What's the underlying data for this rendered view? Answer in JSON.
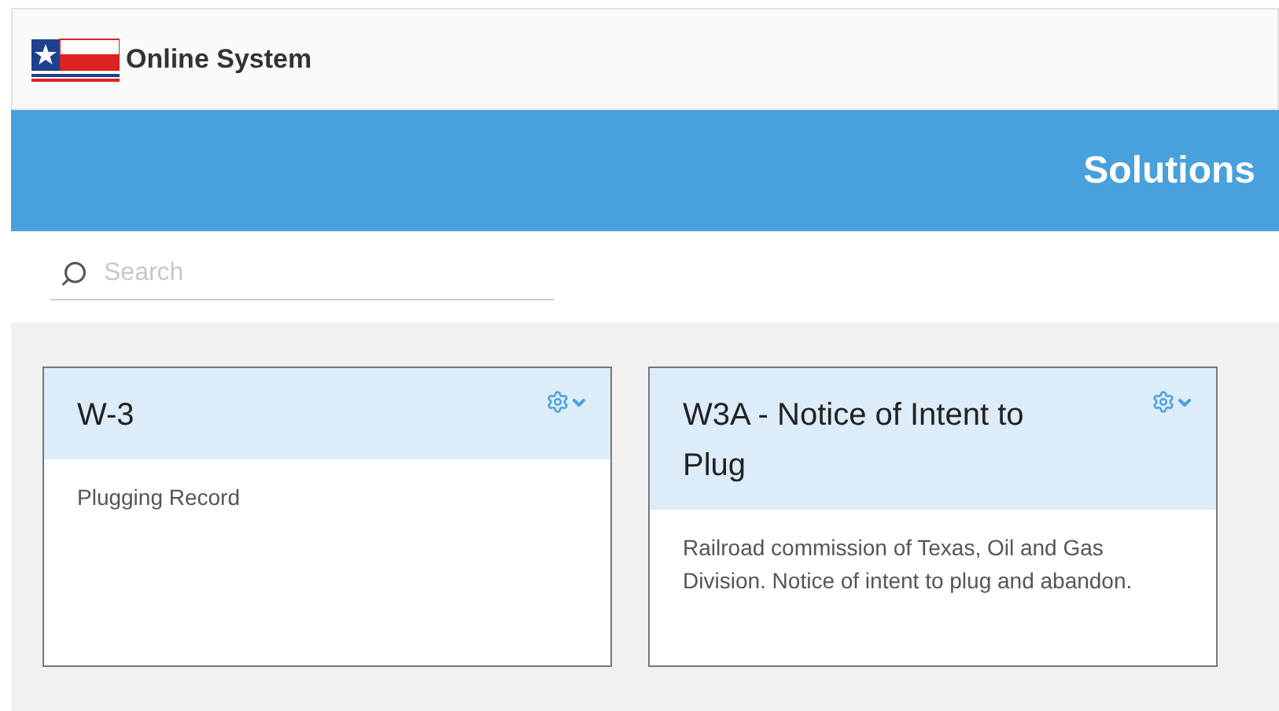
{
  "header": {
    "title": "Online System"
  },
  "banner": {
    "title": "Solutions"
  },
  "search": {
    "placeholder": "Search"
  },
  "cards": [
    {
      "title": "W-3",
      "description": "Plugging Record"
    },
    {
      "title": "W3A - Notice of Intent to Plug",
      "description": "Railroad commission of Texas, Oil and Gas Division. Notice of intent to plug and abandon."
    }
  ]
}
